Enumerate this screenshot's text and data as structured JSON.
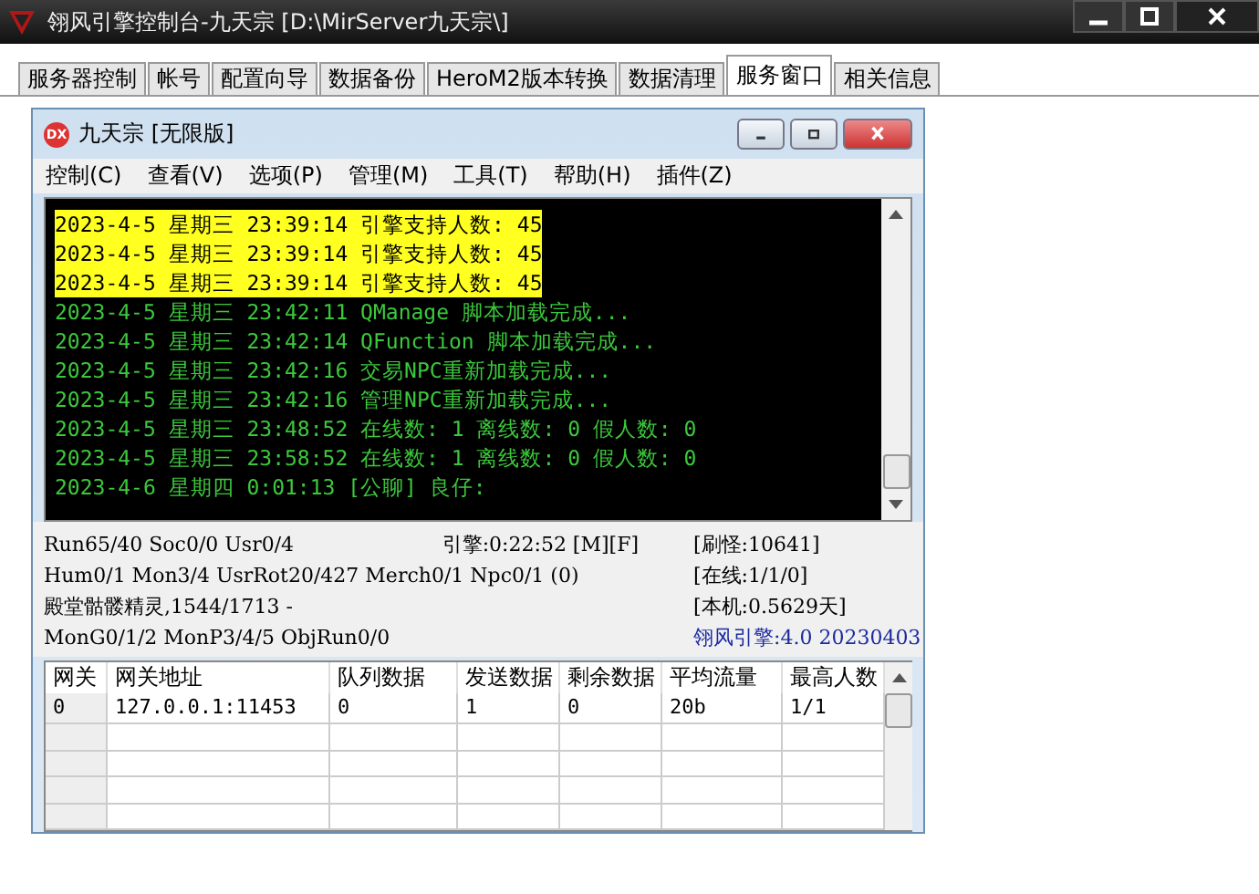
{
  "window": {
    "title": "翎风引擎控制台-九天宗 [D:\\MirServer九天宗\\]"
  },
  "tabs": [
    {
      "label": "服务器控制",
      "selected": false
    },
    {
      "label": "帐号",
      "selected": false
    },
    {
      "label": "配置向导",
      "selected": false
    },
    {
      "label": "数据备份",
      "selected": false
    },
    {
      "label": "HeroM2版本转换",
      "selected": false
    },
    {
      "label": "数据清理",
      "selected": false
    },
    {
      "label": "服务窗口",
      "selected": true
    },
    {
      "label": "相关信息",
      "selected": false
    }
  ],
  "inner_window": {
    "title": "九天宗 [无限版]",
    "icon_text": "DX",
    "menu": [
      "控制(C)",
      "查看(V)",
      "选项(P)",
      "管理(M)",
      "工具(T)",
      "帮助(H)",
      "插件(Z)"
    ],
    "log": [
      {
        "text": "2023-4-5 星期三 23:39:14 引擎支持人数: 45",
        "kind": "highlight"
      },
      {
        "text": "2023-4-5 星期三 23:39:14 引擎支持人数: 45",
        "kind": "highlight"
      },
      {
        "text": "2023-4-5 星期三 23:39:14 引擎支持人数: 45",
        "kind": "highlight"
      },
      {
        "text": "2023-4-5 星期三 23:42:11 QManage 脚本加载完成...",
        "kind": "normal"
      },
      {
        "text": "2023-4-5 星期三 23:42:14 QFunction 脚本加载完成...",
        "kind": "normal"
      },
      {
        "text": "2023-4-5 星期三 23:42:16 交易NPC重新加载完成...",
        "kind": "normal"
      },
      {
        "text": "2023-4-5 星期三 23:42:16 管理NPC重新加载完成...",
        "kind": "normal"
      },
      {
        "text": "2023-4-5 星期三 23:48:52 在线数: 1 离线数: 0 假人数: 0",
        "kind": "normal"
      },
      {
        "text": "2023-4-5 星期三 23:58:52 在线数: 1 离线数: 0 假人数: 0",
        "kind": "normal"
      },
      {
        "text": "2023-4-6 星期四 0:01:13 [公聊] 良仔:",
        "kind": "normal"
      }
    ],
    "status": [
      {
        "left": "Run65/40 Soc0/0 Usr0/4",
        "middle": "引擎:0:22:52 [M][F]",
        "right": "[刷怪:10641]",
        "kind": "normal"
      },
      {
        "left": "Hum0/1 Mon3/4 UsrRot20/427 Merch0/1 Npc0/1 (0)",
        "right": "[在线:1/1/0]",
        "kind": "normal"
      },
      {
        "left": "殿堂骷髅精灵,1544/1713 -",
        "right": "[本机:0.5629天]",
        "kind": "normal"
      },
      {
        "left": "MonG0/1/2 MonP3/4/5 ObjRun0/0",
        "right": "翎风引擎:4.0 20230403",
        "kind": "version"
      }
    ],
    "table": {
      "columns": [
        "网关",
        "网关地址",
        "队列数据",
        "发送数据",
        "剩余数据",
        "平均流量",
        "最高人数"
      ],
      "rows": [
        [
          "0",
          "127.0.0.1:11453",
          "0",
          "1",
          "0",
          "20b",
          "1/1"
        ]
      ]
    }
  }
}
